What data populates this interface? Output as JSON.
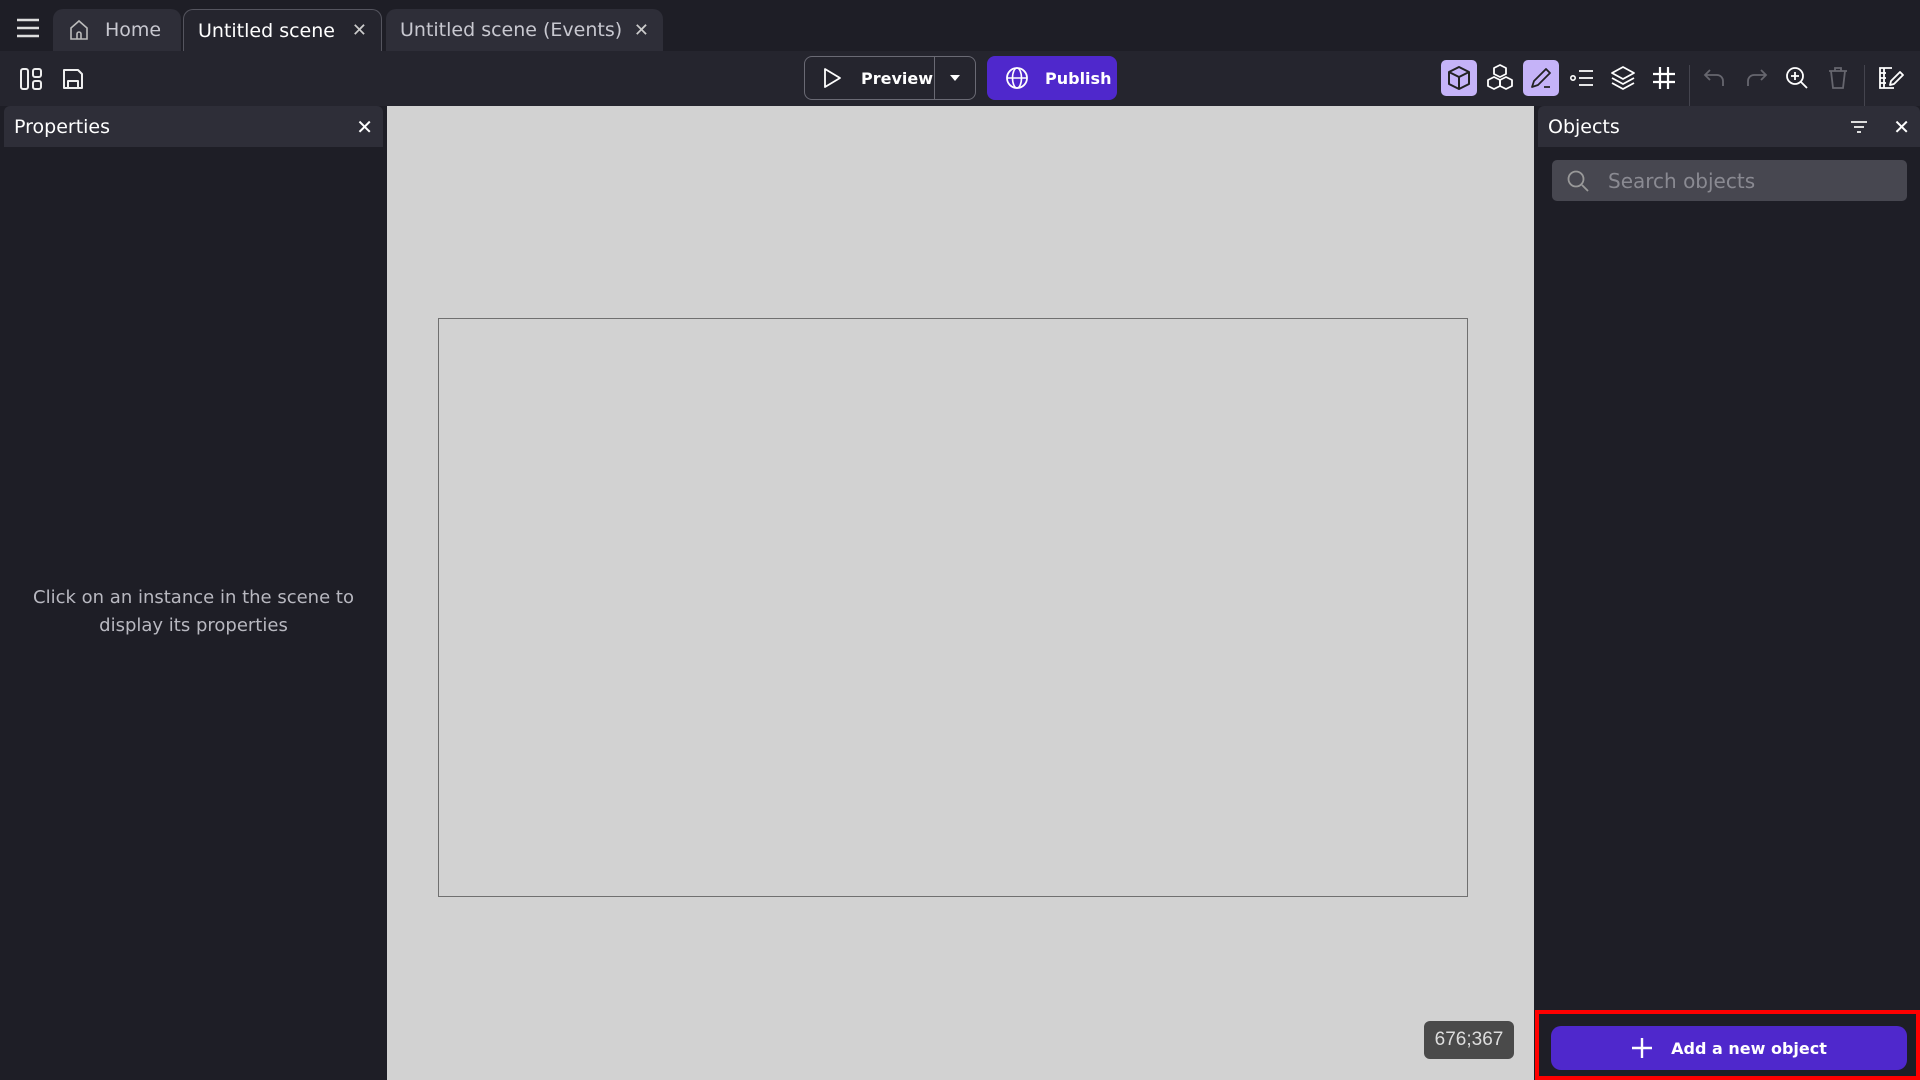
{
  "tabs": [
    {
      "label": "Home",
      "icon": "home-icon"
    },
    {
      "label": "Untitled scene",
      "active": true
    },
    {
      "label": "Untitled scene (Events)"
    }
  ],
  "toolbar": {
    "preview_label": "Preview",
    "publish_label": "Publish"
  },
  "properties": {
    "title": "Properties",
    "empty_message": "Click on an instance in the scene to display its properties"
  },
  "objects": {
    "title": "Objects",
    "search_placeholder": "Search objects",
    "add_label": "Add a new object"
  },
  "canvas": {
    "cursor_coords": "676;367"
  },
  "colors": {
    "accent": "#4f28cc",
    "toggle_on": "#c5b3f8",
    "canvas_bg": "#d2d2d2",
    "highlight": "#ff0000"
  }
}
